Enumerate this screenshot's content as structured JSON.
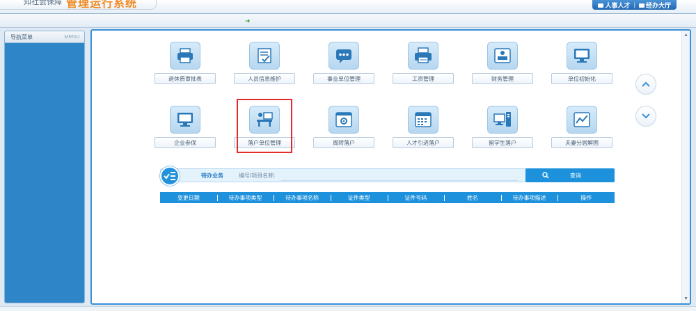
{
  "header": {
    "system_sub": "知社会保障",
    "system_name": "管理运行系统",
    "links": [
      "人事人才",
      "经办大厅"
    ]
  },
  "sidebar": {
    "title": "导航菜单",
    "menu_label": "MENU"
  },
  "apps": [
    {
      "label": "退休费审批表",
      "icon": "printer-icon"
    },
    {
      "label": "人员信息维护",
      "icon": "document-edit-icon"
    },
    {
      "label": "事业单位管理",
      "icon": "chat-bubble-icon"
    },
    {
      "label": "工资管理",
      "icon": "printer-icon"
    },
    {
      "label": "财务管理",
      "icon": "presentation-icon"
    },
    {
      "label": "单位初始化",
      "icon": "monitor-icon"
    },
    {
      "label": "企业参保",
      "icon": "monitor-icon"
    },
    {
      "label": "落户单位管理",
      "icon": "desk-person-icon"
    },
    {
      "label": "周转落户",
      "icon": "window-gear-icon"
    },
    {
      "label": "人才引进落户",
      "icon": "calendar-icon"
    },
    {
      "label": "留学生落户",
      "icon": "computer-tower-icon"
    },
    {
      "label": "夫妻分居解困",
      "icon": "line-chart-icon"
    }
  ],
  "todo": {
    "title": "待办业务",
    "search_label": "编号/项目名称:",
    "search_value": "",
    "query_label": "查询",
    "columns": [
      "变更日期",
      "待办事项类型",
      "待办事项名称",
      "证件类型",
      "证件号码",
      "姓名",
      "待办事项描述",
      "操作"
    ]
  },
  "colors": {
    "accent": "#1e91dc",
    "highlight": "#e22b2b",
    "sidebar": "#2e86c8"
  }
}
